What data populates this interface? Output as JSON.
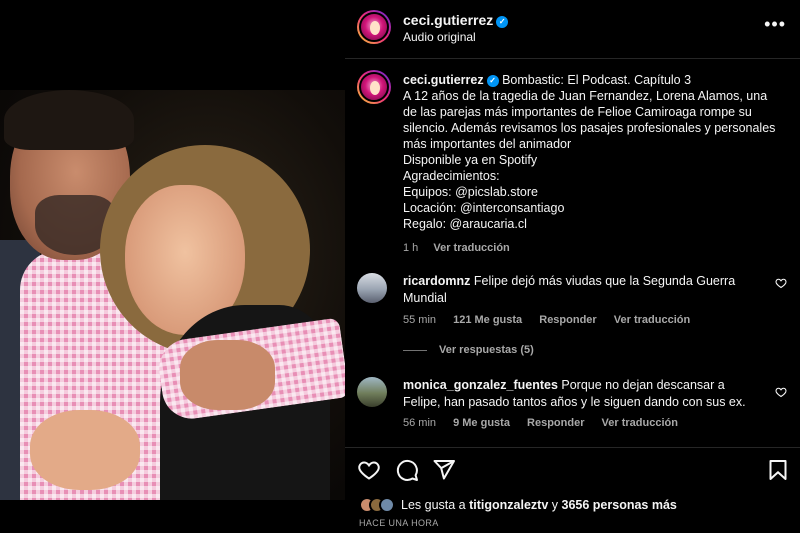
{
  "post": {
    "username": "ceci.gutierrez",
    "audio": "Audio original",
    "more_label": "•••"
  },
  "caption": {
    "username": "ceci.gutierrez",
    "lines": [
      "Bombastic: El Podcast. Capítulo 3",
      "A 12 años de la tragedia de Juan Fernandez, Lorena Alamos, una de las parejas más importantes de Felioe Camiroaga rompe su silencio. Además revisamos los pasajes profesionales y personales más importantes del animador",
      "Disponible ya en Spotify",
      "Agradecimientos:",
      "Equipos: @picslab.store",
      "Locación: @interconsantiago",
      "Regalo: @araucaria.cl"
    ],
    "time": "1 h",
    "translate": "Ver traducción"
  },
  "comments": [
    {
      "username": "ricardomnz",
      "text": "Felipe dejó más viudas que la Segunda Guerra Mundial",
      "time": "55 min",
      "likes": "121 Me gusta",
      "reply": "Responder",
      "translate": "Ver traducción"
    },
    {
      "username": "monica_gonzalez_fuentes",
      "text": "Porque no dejan descansar a Felipe, han pasado tantos años y le siguen dando con sus ex.",
      "time": "56 min",
      "likes": "9 Me gusta",
      "reply": "Responder",
      "translate": "Ver traducción"
    }
  ],
  "replies_label": "Ver respuestas (5)",
  "likes": {
    "prefix": "Les gusta a",
    "user": "titigonzaleztv",
    "middle": "y",
    "count": "3656 personas más"
  },
  "time_ago": "HACE UNA HORA",
  "colors": {
    "background": "#000000",
    "text": "#f5f5f5",
    "muted": "#a8a8a8",
    "verified": "#0095f6"
  },
  "icons": [
    "heart-icon",
    "comment-icon",
    "share-icon",
    "bookmark-icon",
    "verified-icon",
    "more-icon"
  ]
}
